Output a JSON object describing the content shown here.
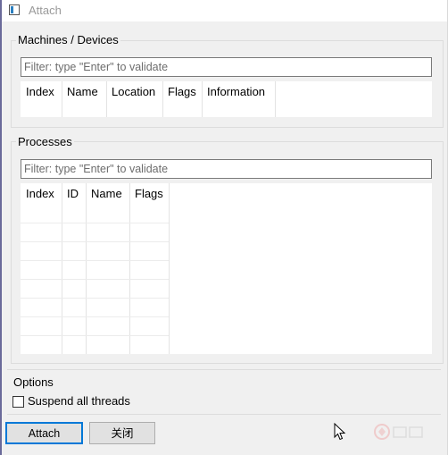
{
  "window": {
    "title": "Attach"
  },
  "machines": {
    "group_label": "Machines / Devices",
    "filter_placeholder": "Filter: type \"Enter\" to validate",
    "columns": [
      "Index",
      "Name",
      "Location",
      "Flags",
      "Information"
    ]
  },
  "processes": {
    "group_label": "Processes",
    "filter_placeholder": "Filter: type \"Enter\" to validate",
    "columns": [
      "Index",
      "ID",
      "Name",
      "Flags"
    ]
  },
  "options": {
    "label": "Options",
    "suspend_label": "Suspend all threads",
    "suspend_checked": false
  },
  "buttons": {
    "attach": "Attach",
    "close": "关闭"
  },
  "colors": {
    "focus_border": "#0078d7",
    "window_bg": "#f0f0f0"
  }
}
